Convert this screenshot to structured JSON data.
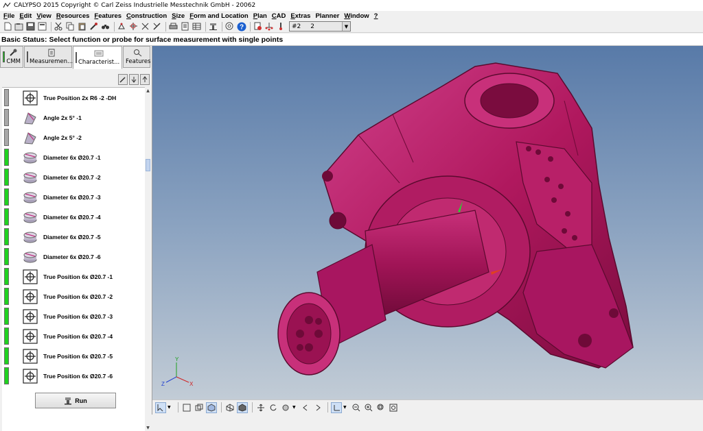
{
  "window": {
    "title": "CALYPSO 2015 Copyright © Carl Zeiss Industrielle Messtechnik GmbH - 20062"
  },
  "menu": [
    {
      "label": "File",
      "mnemonic": "F",
      "rest": "ile"
    },
    {
      "label": "Edit",
      "mnemonic": "E",
      "rest": "dit"
    },
    {
      "label": "View",
      "mnemonic": "V",
      "rest": "iew"
    },
    {
      "label": "Resources",
      "mnemonic": "R",
      "rest": "esources"
    },
    {
      "label": "Features",
      "mnemonic": "F",
      "rest": "eatures"
    },
    {
      "label": "Construction",
      "mnemonic": "C",
      "rest": "onstruction"
    },
    {
      "label": "Size",
      "mnemonic": "S",
      "rest": "ize"
    },
    {
      "label": "Form and Location",
      "mnemonic": "F",
      "rest": "orm and Location"
    },
    {
      "label": "Plan",
      "mnemonic": "P",
      "rest": "lan"
    },
    {
      "label": "CAD",
      "mnemonic": "C",
      "rest": "AD"
    },
    {
      "label": "Extras",
      "mnemonic": "E",
      "rest": "xtras"
    },
    {
      "label": "Planner",
      "mnemonic": "",
      "rest": "Planner"
    },
    {
      "label": "Window",
      "mnemonic": "W",
      "rest": "indow"
    },
    {
      "label": "?",
      "mnemonic": "?",
      "rest": ""
    }
  ],
  "toolbar": {
    "probe_combo": {
      "value1": "#2",
      "value2": "2"
    }
  },
  "status": {
    "text": "Basic Status: Select function or probe for surface measurement with single points"
  },
  "tabs": [
    {
      "label": "CMM",
      "flag": "#1fd21f",
      "active": false
    },
    {
      "label": "Measuremen...",
      "flag": "#f2ea10",
      "active": false
    },
    {
      "label": "Characterist...",
      "flag": "#ffffff",
      "active": true
    },
    {
      "label": "Features",
      "flag": "",
      "active": false
    }
  ],
  "characteristics": [
    {
      "label": "True Position 2x R6 -2 -DH",
      "status": "gray",
      "icon": "true-position-icon"
    },
    {
      "label": "Angle 2x 5° -1",
      "status": "gray",
      "icon": "angle-icon"
    },
    {
      "label": "Angle 2x 5° -2",
      "status": "gray",
      "icon": "angle-icon"
    },
    {
      "label": "Diameter 6x Ø20.7 -1",
      "status": "green",
      "icon": "diameter-icon"
    },
    {
      "label": "Diameter 6x Ø20.7 -2",
      "status": "green",
      "icon": "diameter-icon"
    },
    {
      "label": "Diameter 6x Ø20.7 -3",
      "status": "green",
      "icon": "diameter-icon"
    },
    {
      "label": "Diameter 6x Ø20.7 -4",
      "status": "green",
      "icon": "diameter-icon"
    },
    {
      "label": "Diameter 6x Ø20.7 -5",
      "status": "green",
      "icon": "diameter-icon"
    },
    {
      "label": "Diameter 6x Ø20.7 -6",
      "status": "green",
      "icon": "diameter-icon"
    },
    {
      "label": "True Position 6x Ø20.7 -1",
      "status": "green",
      "icon": "true-position-icon"
    },
    {
      "label": "True Position 6x Ø20.7 -2",
      "status": "green",
      "icon": "true-position-icon"
    },
    {
      "label": "True Position 6x Ø20.7 -3",
      "status": "green",
      "icon": "true-position-icon"
    },
    {
      "label": "True Position 6x Ø20.7 -4",
      "status": "green",
      "icon": "true-position-icon"
    },
    {
      "label": "True Position 6x Ø20.7 -5",
      "status": "green",
      "icon": "true-position-icon"
    },
    {
      "label": "True Position 6x Ø20.7 -6",
      "status": "green",
      "icon": "true-position-icon"
    }
  ],
  "run_button": {
    "label": "Run"
  },
  "viewport": {
    "axes": {
      "x": "X",
      "y": "Y",
      "z": "Z"
    },
    "part_color": "#b0185e"
  },
  "colors": {
    "ok": "#1fd21f",
    "inactive": "#a8a8a8"
  }
}
